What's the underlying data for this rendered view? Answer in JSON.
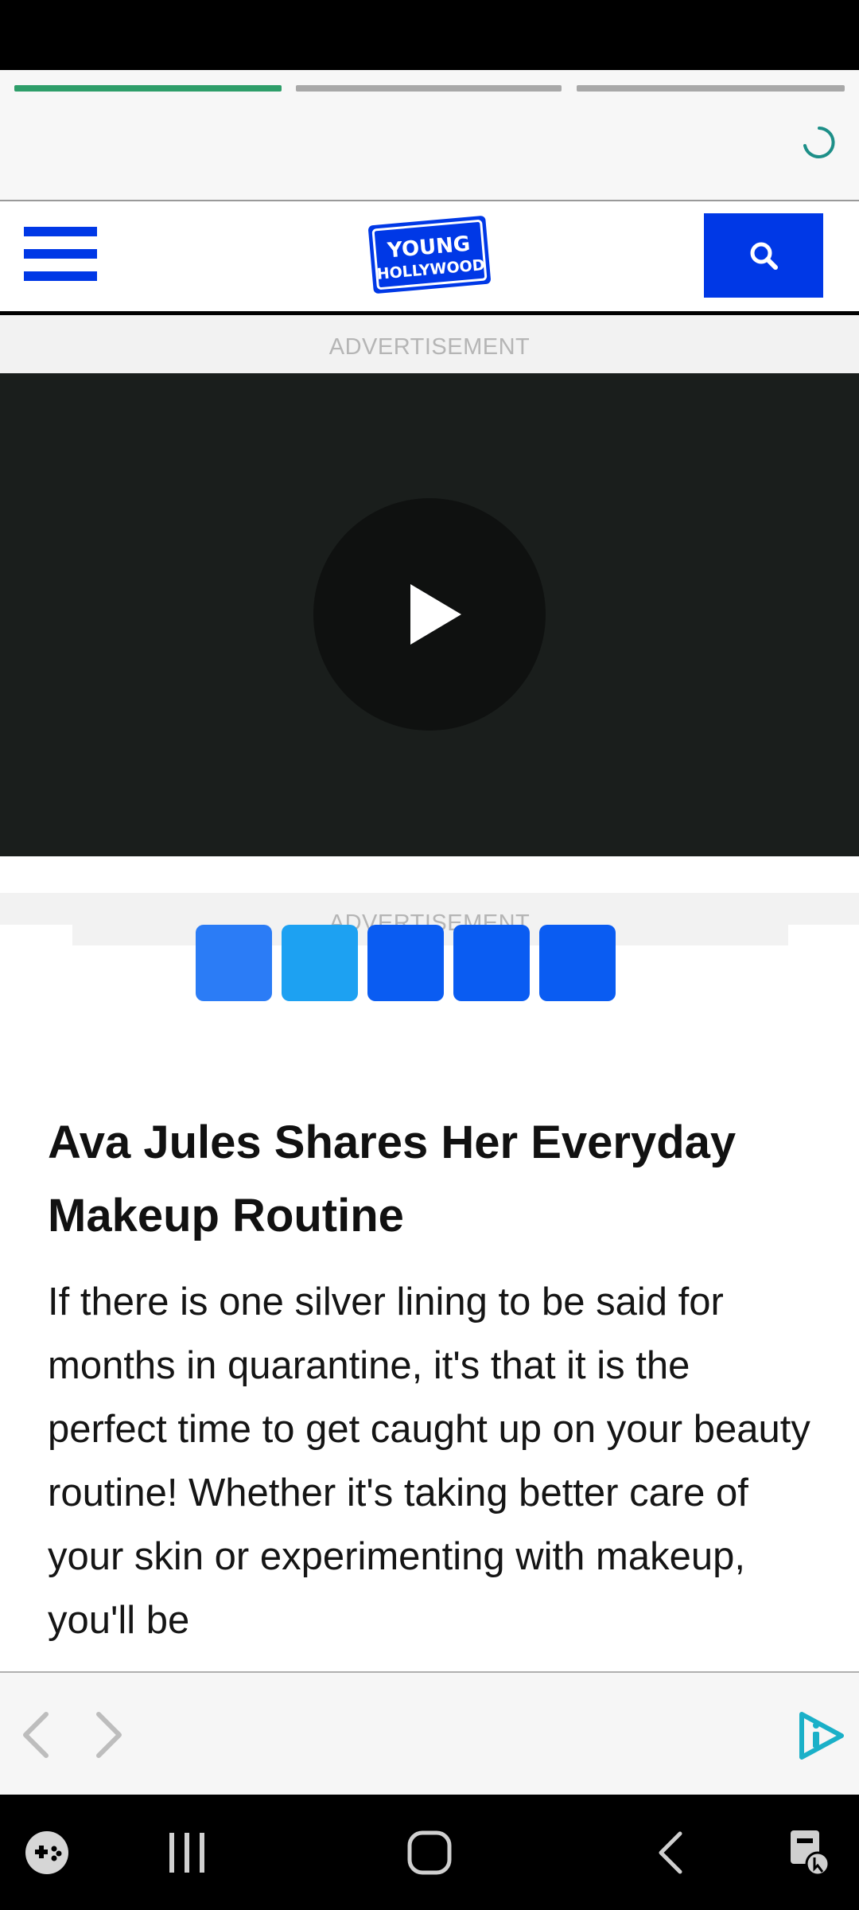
{
  "story_progress": {
    "segments": [
      {
        "label": "story-1",
        "state": "active",
        "color": "#2e9e6a"
      },
      {
        "label": "story-2",
        "state": "inactive",
        "color": "#a8a8a8"
      },
      {
        "label": "story-3",
        "state": "inactive",
        "color": "#a8a8a8"
      }
    ]
  },
  "header": {
    "logo_line1": "YOUNG",
    "logo_line2": "HOLLYWOOD",
    "menu_icon": "hamburger-icon",
    "search_icon": "search-icon",
    "brand_color": "#0038e6"
  },
  "ads": {
    "label_top": "ADVERTISEMENT",
    "label_bottom": "ADVERTISEMENT"
  },
  "video": {
    "play_icon": "play-icon"
  },
  "share_buttons": [
    {
      "name": "share-facebook-button",
      "color": "#2b7cf6"
    },
    {
      "name": "share-twitter-button",
      "color": "#1da1f2"
    },
    {
      "name": "share-button-3",
      "color": "#0a5cf2"
    },
    {
      "name": "share-button-4",
      "color": "#0a5cf2"
    },
    {
      "name": "share-button-5",
      "color": "#0a5cf2"
    }
  ],
  "article": {
    "title": "Ava Jules Shares Her Everyday Makeup Routine",
    "body": "If there is one silver lining to be said for months in quarantine, it's that it is the perfect time to get caught up on your beauty routine! Whether it's taking better care of your skin or experimenting with makeup, you'll be"
  },
  "browser_toolbar": {
    "back_icon": "chevron-left-icon",
    "forward_icon": "chevron-right-icon",
    "info_icon": "ad-info-icon",
    "accent": "#1ab0c8"
  },
  "system_nav": {
    "items": [
      "game-launcher-icon",
      "recent-apps-icon",
      "home-icon",
      "back-icon",
      "accessibility-icon"
    ]
  }
}
